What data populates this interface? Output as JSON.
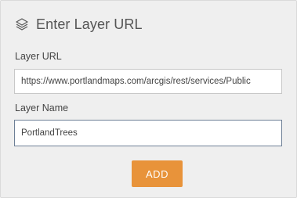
{
  "header": {
    "icon": "layers-icon",
    "title": "Enter Layer URL"
  },
  "form": {
    "layer_url": {
      "label": "Layer URL",
      "value": "https://www.portlandmaps.com/arcgis/rest/services/Public"
    },
    "layer_name": {
      "label": "Layer Name",
      "value": "PortlandTrees"
    },
    "add_label": "ADD",
    "add_color": "#E8933A"
  }
}
